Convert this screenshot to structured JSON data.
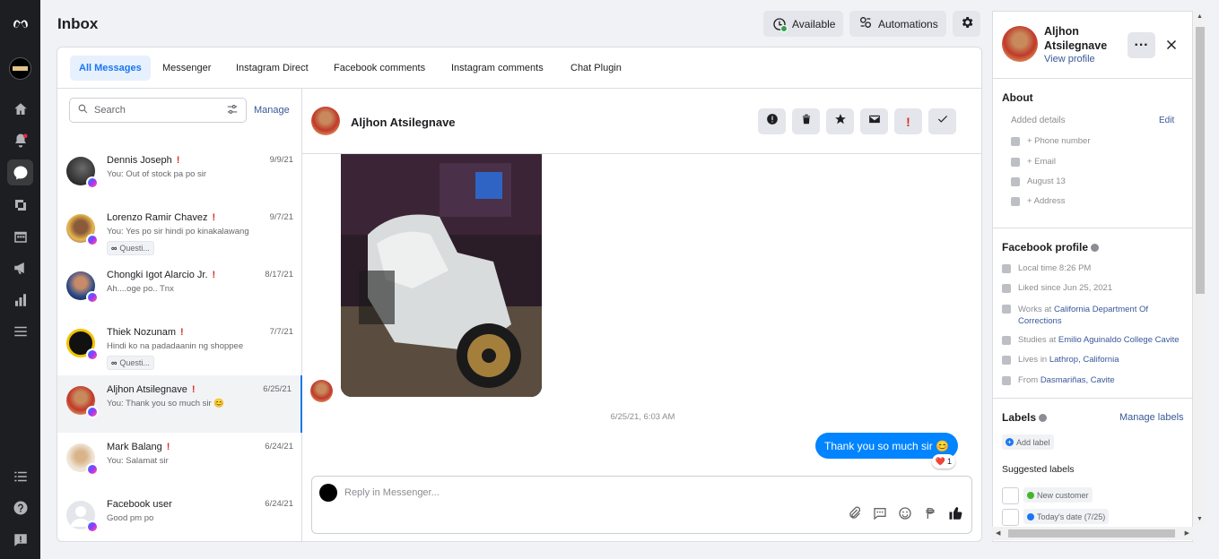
{
  "page": {
    "title": "Inbox"
  },
  "toolbar": {
    "available_label": "Available",
    "automations_label": "Automations"
  },
  "tabs": [
    {
      "label": "All Messages"
    },
    {
      "label": "Messenger"
    },
    {
      "label": "Instagram Direct"
    },
    {
      "label": "Facebook comments"
    },
    {
      "label": "Instagram comments"
    },
    {
      "label": "Chat Plugin"
    }
  ],
  "search": {
    "placeholder": "Search",
    "manage_label": "Manage"
  },
  "conversations": [
    {
      "name": "Dennis Joseph",
      "snippet": "You: Out of stock pa po sir",
      "date": "9/9/21",
      "tag": ""
    },
    {
      "name": "Lorenzo Ramir Chavez",
      "snippet": "You: Yes po sir hindi po kinakalawang",
      "date": "9/7/21",
      "tag": "Questi..."
    },
    {
      "name": "Chongki Igot Alarcio Jr.",
      "snippet": "Ah....oge po.. Tnx",
      "date": "8/17/21",
      "tag": ""
    },
    {
      "name": "Thiek Nozunam",
      "snippet": "Hindi ko na padadaanin ng shoppee",
      "date": "7/7/21",
      "tag": "Questi..."
    },
    {
      "name": "Aljhon Atsilegnave",
      "snippet": "You: Thank you so much sir 😊",
      "date": "6/25/21",
      "tag": ""
    },
    {
      "name": "Mark Balang",
      "snippet": "You: Salamat sir",
      "date": "6/24/21",
      "tag": ""
    },
    {
      "name": "Facebook user",
      "snippet": "Good pm po",
      "date": "6/24/21",
      "tag": ""
    }
  ],
  "conv_excl": "!",
  "chat": {
    "name": "Aljhon Atsilegnave",
    "timestamp": "6/25/21, 6:03 AM",
    "outgoing_message": "Thank you so much sir 😊",
    "reaction": "❤️",
    "reaction_count": "1",
    "reply_placeholder": "Reply in Messenger..."
  },
  "profile": {
    "name": "Aljhon Atsilegnave",
    "view_profile": "View profile",
    "about_title": "About",
    "added_details": "Added details",
    "edit_label": "Edit",
    "phone": "+ Phone number",
    "email": "+ Email",
    "birthday": "August 13",
    "address": "+ Address",
    "fb_profile_title": "Facebook profile",
    "local_time": "Local time 8:26 PM",
    "liked_since": "Liked since Jun 25, 2021",
    "works_prefix": "Works at",
    "works_at": "California Department Of Corrections",
    "studies_prefix": "Studies at",
    "studies_at": "Emilio Aguinaldo College Cavite",
    "lives_prefix": "Lives in",
    "lives_in": "Lathrop, California",
    "from_prefix": "From",
    "from": "Dasmariñas, Cavite",
    "labels_title": "Labels",
    "manage_labels": "Manage labels",
    "add_label": "Add label",
    "suggested_title": "Suggested labels",
    "suggested": [
      {
        "label": "New customer",
        "color": "#42b72a"
      },
      {
        "label": "Today's date (7/25)",
        "color": "#1877f2"
      }
    ]
  },
  "colors": {
    "accent": "#1877f2",
    "bubble": "#0084ff",
    "alert": "#d93025",
    "online": "#31a24c"
  }
}
